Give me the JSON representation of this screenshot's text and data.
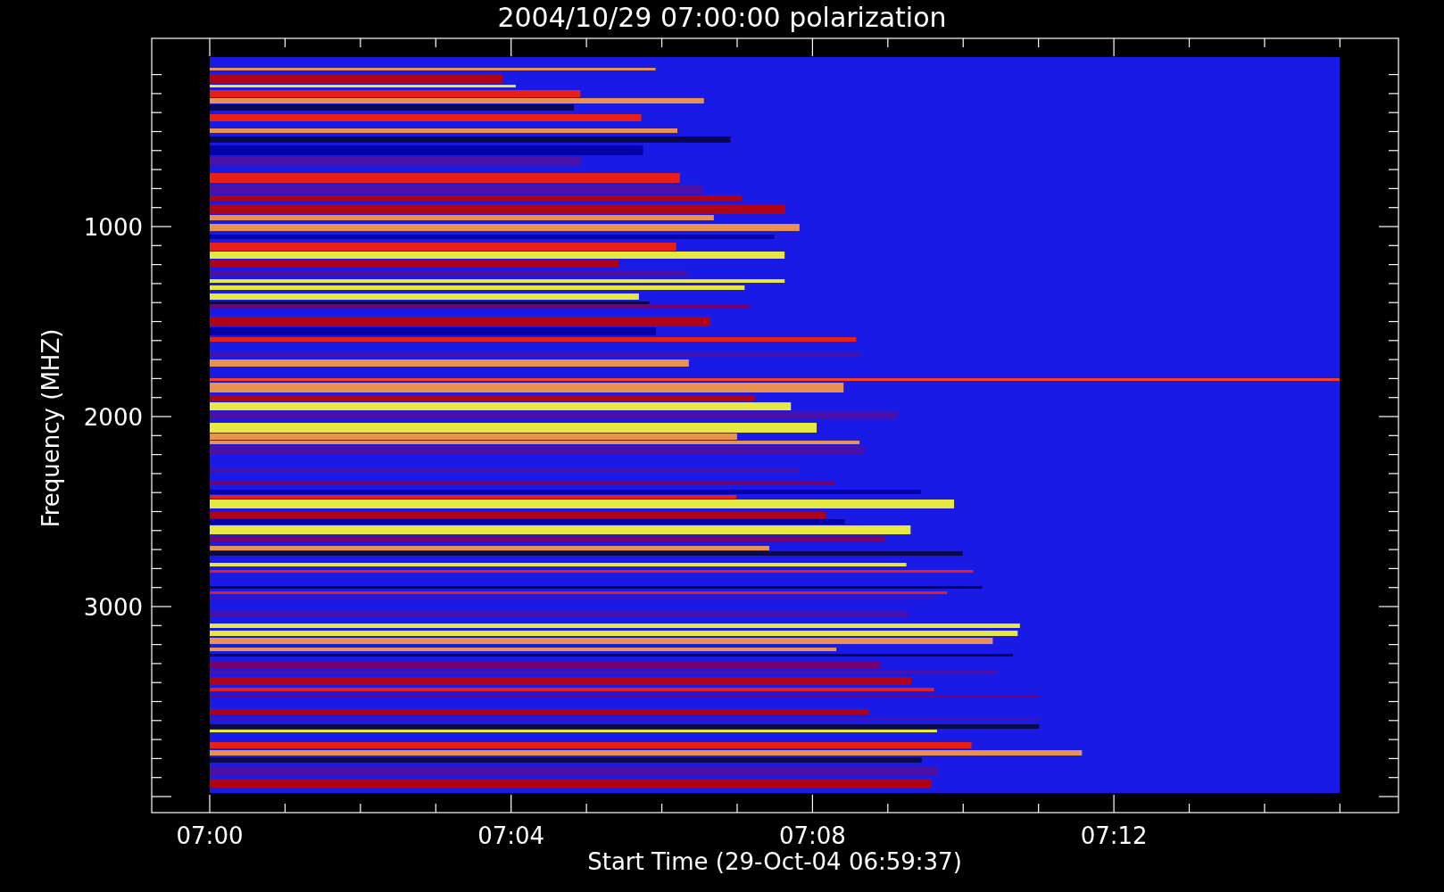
{
  "title": "2004/10/29 07:00:00 polarization",
  "y_axis": {
    "label": "Frequency (MHZ)",
    "ticks": [
      "1000",
      "2000",
      "3000"
    ]
  },
  "x_axis": {
    "label": "Start Time (29-Oct-04 06:59:37)",
    "ticks": [
      "07:00",
      "07:04",
      "07:08",
      "07:12"
    ]
  }
}
